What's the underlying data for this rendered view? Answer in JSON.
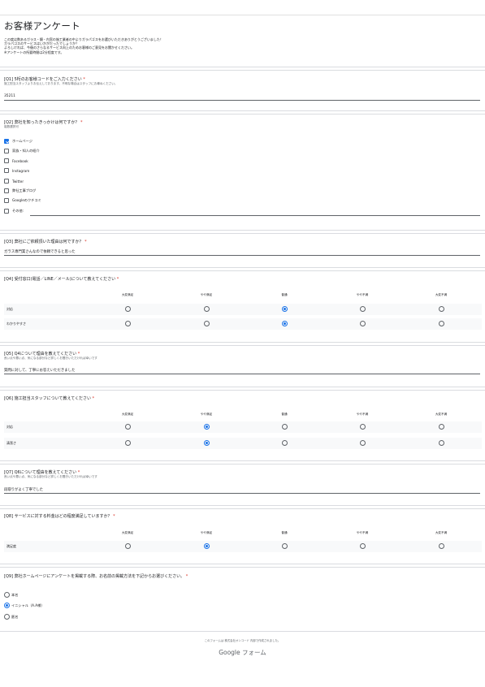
{
  "form": {
    "title": "お客様アンケート",
    "description_lines": [
      "この度は数あるガラス・鏡・内窓の施工業者の中よりガラパゴスをお選びいただきありがとうございました！",
      "ガラパゴスのサービスはいかがだったでしょうか？",
      "よろしければ、今後のさらなるサービス向上のためお客様のご意見をお聞かせください。",
      "※アンケートの所要時間は2分程度です。"
    ]
  },
  "q1": {
    "title": "[Q1] 5桁のお客様コードをご入力ください",
    "help": "施工担当スタッフよりお伝えしております。不明な場合はスタッフにお尋ねください。",
    "answer": "35211"
  },
  "q2": {
    "title": "[Q2] 弊社を知ったきっかけは何ですか？",
    "help": "複数選択可",
    "options": [
      {
        "label": "ホームページ",
        "checked": true
      },
      {
        "label": "家族・知人の紹介",
        "checked": false
      },
      {
        "label": "Facebook",
        "checked": false
      },
      {
        "label": "Instagram",
        "checked": false
      },
      {
        "label": "Twitter",
        "checked": false
      },
      {
        "label": "弊社工事ブログ",
        "checked": false
      },
      {
        "label": "Googleのクチコミ",
        "checked": false
      },
      {
        "label": "その他:",
        "checked": false
      }
    ]
  },
  "q3": {
    "title": "[Q3] 弊社にご依頼頂いた理由は何ですか？",
    "answer": "ガラス専門業さんなので依頼できると思った"
  },
  "scale": [
    "大変満足",
    "やや満足",
    "普通",
    "やや不満",
    "大変不満"
  ],
  "q4": {
    "title": "[Q4] 受付窓口(電話／LINE／メール)について教えてください",
    "rows": [
      {
        "label": "対応",
        "selected": 2
      },
      {
        "label": "わかりやすさ",
        "selected": 2
      }
    ]
  },
  "q5": {
    "title": "[Q5] Q4について理由を教えてください",
    "help": "良い点や悪い点、気になる部分など詳しくお聞きいただければ幸いです",
    "answer": "質問に対して、丁寧にお答えいただきました"
  },
  "q6": {
    "title": "[Q6] 施工担当スタッフについて教えてください",
    "rows": [
      {
        "label": "対応",
        "selected": 1
      },
      {
        "label": "清潔さ",
        "selected": 1
      }
    ]
  },
  "q7": {
    "title": "[Q7] Q6について理由を教えてください",
    "help": "良い点や悪い点、気になる部分など詳しくお聞きいただければ幸いです",
    "answer": "段取りがよく丁寧でした"
  },
  "q8": {
    "title": "[Q8] サービスに対する料金はどの程度満足していますか？",
    "rows": [
      {
        "label": "満足度",
        "selected": 1
      }
    ]
  },
  "q9": {
    "title": "[Q9] 弊社ホームページにアンケートを掲載する際、お名前の掲載方法を下記からお選びください。",
    "options": [
      {
        "label": "本名",
        "selected": false
      },
      {
        "label": "イニシャル（A.A様）",
        "selected": true
      },
      {
        "label": "匿名",
        "selected": false
      }
    ]
  },
  "footer": {
    "note": "このフォームは 株式会社オンコード 内部で作成されました。",
    "brand": "Google フォーム"
  },
  "required_mark": "*",
  "colors": {
    "accent": "#1a73e8",
    "required": "#d93025"
  }
}
